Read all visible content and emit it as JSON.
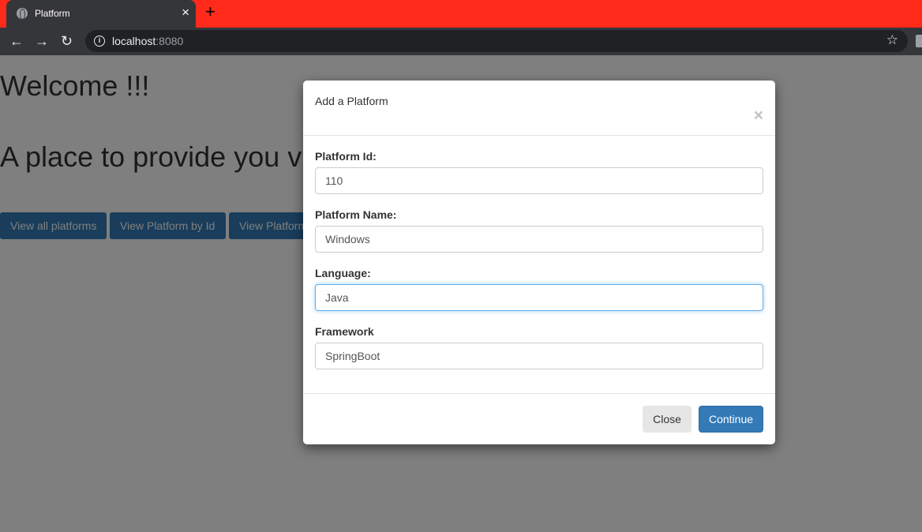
{
  "browser": {
    "tab_title": "Platform",
    "tab_close": "×",
    "new_tab": "+",
    "url_host": "localhost",
    "url_port": ":8080",
    "back": "←",
    "forward": "→",
    "reload": "↻",
    "info": "i",
    "star": "☆"
  },
  "page": {
    "welcome": "Welcome !!!",
    "tagline": "A place to provide you v",
    "buttons": [
      "View all platforms",
      "View Platform by Id",
      "View Platform"
    ]
  },
  "modal": {
    "title": "Add a Platform",
    "close_glyph": "×",
    "fields": [
      {
        "label": "Platform Id:",
        "value": "110"
      },
      {
        "label": "Platform Name:",
        "value": "Windows"
      },
      {
        "label": "Language:",
        "value": "Java"
      },
      {
        "label": "Framework",
        "value": "SpringBoot"
      }
    ],
    "close_label": "Close",
    "continue_label": "Continue"
  },
  "colors": {
    "tabbar": "#ff2a1a",
    "chrome": "#35363a",
    "primary": "#337ab7",
    "backdrop": "rgba(0,0,0,0.5)"
  }
}
